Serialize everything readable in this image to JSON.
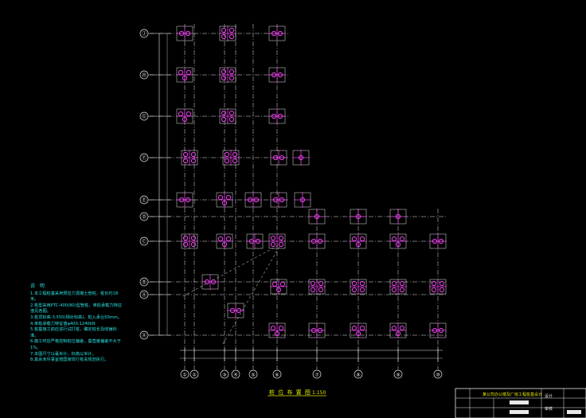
{
  "drawing": {
    "title": "桩 位 布 置 图",
    "scale": "1:150",
    "colors": {
      "background": "#000000",
      "axis": "#e8e8e8",
      "pile": "#e040e0",
      "dimension": "#29e0e0",
      "title": "#e6e600"
    }
  },
  "grid": {
    "row_labels": [
      "Ⓙ",
      "Ⓗ",
      "Ⓖ",
      "Ⓕ",
      "Ⓔ",
      "Ⓓ",
      "Ⓒ",
      "Ⓑ",
      "Ⓐ",
      "Ⓐ"
    ],
    "col_labels": [
      "①",
      "②",
      "③",
      "④",
      "⑤",
      "⑥",
      "⑦",
      "⑧",
      "⑨",
      "⑩"
    ]
  },
  "notes": {
    "header": "说 明",
    "items": [
      "1.本工程桩基采用预应力混凝土管桩，桩长约18米。",
      "2.桩型采用PTC-400(80)型管桩，单桩承载力特征值见各图。",
      "3.桩顶标高-3.550(相对标高)，桩入承台50mm。",
      "4.单桩承载力特征值φ400:1240kN",
      "5.桩基施工前应进行试打桩，确定桩长及收锤标准。",
      "6.施工时应严格控制桩位偏差，垂直度偏差不大于1%。",
      "7.本图尺寸以毫米计，标高以米计。",
      "8.其余未尽事宜按国家现行有关规范执行。"
    ]
  },
  "title_block": {
    "project": "某公司办公楼及厂房工程桩基设计",
    "label_design": "设计",
    "label_check": "审核"
  }
}
